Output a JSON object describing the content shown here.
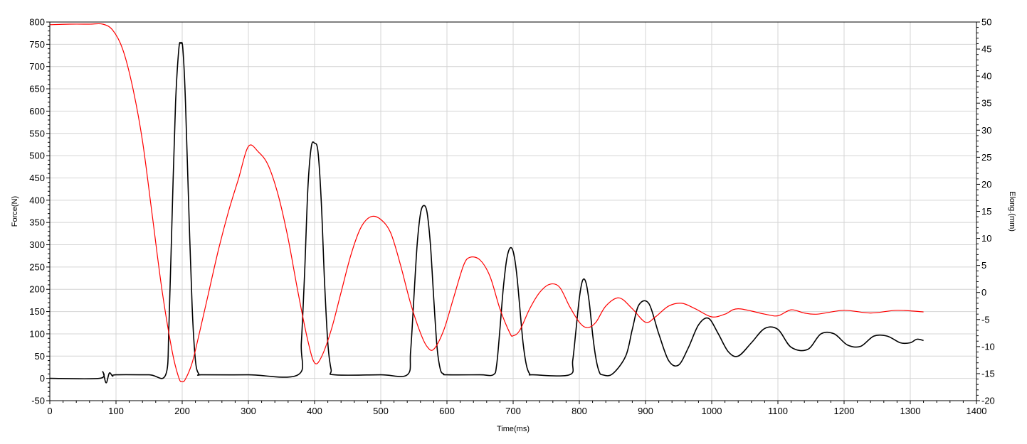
{
  "chart_data": {
    "type": "line",
    "title": "",
    "xlabel": "Time(ms)",
    "ylabel": "Force(N)",
    "y2label": "Elong.(mm)",
    "xlim": [
      0,
      1400
    ],
    "ylim": [
      -50,
      800
    ],
    "y2lim": [
      -20,
      50
    ],
    "x_ticks": [
      0,
      100,
      200,
      300,
      400,
      500,
      600,
      700,
      800,
      900,
      1000,
      1100,
      1200,
      1300,
      1400
    ],
    "y_ticks": [
      -50,
      0,
      50,
      100,
      150,
      200,
      250,
      300,
      350,
      400,
      450,
      500,
      550,
      600,
      650,
      700,
      750,
      800
    ],
    "y2_ticks": [
      -20,
      -15,
      -10,
      -5,
      0,
      5,
      10,
      15,
      20,
      25,
      30,
      35,
      40,
      45,
      50
    ],
    "grid": true,
    "legend": "none",
    "series": [
      {
        "axis": "left",
        "color": "#000000",
        "x": [
          0,
          75,
          80,
          85,
          90,
          95,
          100,
          150,
          175,
          180,
          185,
          190,
          195,
          198,
          201,
          205,
          210,
          215,
          220,
          225,
          230,
          300,
          375,
          380,
          385,
          390,
          395,
          400,
          405,
          410,
          415,
          420,
          425,
          430,
          500,
          540,
          545,
          550,
          555,
          560,
          565,
          570,
          575,
          580,
          585,
          590,
          595,
          600,
          650,
          670,
          675,
          680,
          685,
          690,
          695,
          700,
          705,
          710,
          715,
          720,
          725,
          730,
          785,
          790,
          795,
          800,
          805,
          810,
          815,
          820,
          825,
          830,
          835,
          850,
          870,
          880,
          890,
          905,
          920,
          935,
          950,
          965,
          980,
          995,
          1010,
          1025,
          1040,
          1060,
          1080,
          1100,
          1120,
          1145,
          1165,
          1185,
          1205,
          1225,
          1245,
          1265,
          1285,
          1300,
          1310,
          1320
        ],
        "values": [
          0,
          0,
          15,
          -10,
          12,
          5,
          8,
          8,
          8,
          120,
          380,
          620,
          740,
          752,
          740,
          620,
          380,
          160,
          40,
          10,
          8,
          8,
          8,
          80,
          240,
          430,
          520,
          528,
          510,
          400,
          220,
          80,
          20,
          8,
          8,
          8,
          60,
          180,
          300,
          370,
          388,
          372,
          300,
          180,
          70,
          20,
          10,
          8,
          8,
          8,
          30,
          110,
          200,
          265,
          292,
          285,
          240,
          160,
          80,
          30,
          10,
          8,
          8,
          40,
          110,
          180,
          220,
          215,
          170,
          100,
          45,
          15,
          8,
          10,
          50,
          110,
          165,
          168,
          100,
          40,
          30,
          70,
          120,
          135,
          100,
          60,
          50,
          80,
          112,
          110,
          70,
          65,
          100,
          100,
          75,
          72,
          95,
          95,
          80,
          80,
          88,
          85
        ]
      },
      {
        "axis": "right",
        "color": "#ff0000",
        "x": [
          0,
          30,
          60,
          80,
          95,
          110,
          125,
          140,
          155,
          170,
          185,
          195,
          200,
          205,
          215,
          225,
          240,
          255,
          270,
          285,
          300,
          315,
          330,
          345,
          360,
          375,
          390,
          400,
          410,
          425,
          440,
          455,
          470,
          485,
          500,
          515,
          530,
          545,
          560,
          570,
          580,
          595,
          610,
          625,
          635,
          650,
          665,
          680,
          695,
          700,
          710,
          725,
          740,
          755,
          770,
          785,
          800,
          812,
          825,
          840,
          860,
          880,
          900,
          915,
          935,
          955,
          975,
          1000,
          1020,
          1040,
          1080,
          1100,
          1120,
          1140,
          1160,
          1200,
          1240,
          1280,
          1320
        ],
        "values": [
          49.5,
          49.6,
          49.6,
          49.6,
          48.5,
          45,
          38,
          28,
          14,
          0,
          -11,
          -15.8,
          -16.5,
          -16,
          -13,
          -8,
          0,
          8,
          15,
          21,
          27,
          26,
          23.5,
          18,
          10,
          0,
          -9,
          -13,
          -12,
          -7,
          0,
          7,
          12,
          14,
          13.5,
          11,
          5,
          -2,
          -7.5,
          -10,
          -10.5,
          -7,
          -1,
          5,
          6.5,
          6,
          3,
          -3,
          -7.5,
          -8,
          -7,
          -3,
          0,
          1.5,
          1,
          -2.5,
          -5.5,
          -6.5,
          -5.5,
          -2.5,
          -1,
          -3,
          -5.5,
          -4.5,
          -2.5,
          -2,
          -3,
          -4.5,
          -4,
          -3,
          -4,
          -4.3,
          -3.2,
          -3.8,
          -4,
          -3.3,
          -3.8,
          -3.3,
          -3.6
        ]
      }
    ]
  }
}
